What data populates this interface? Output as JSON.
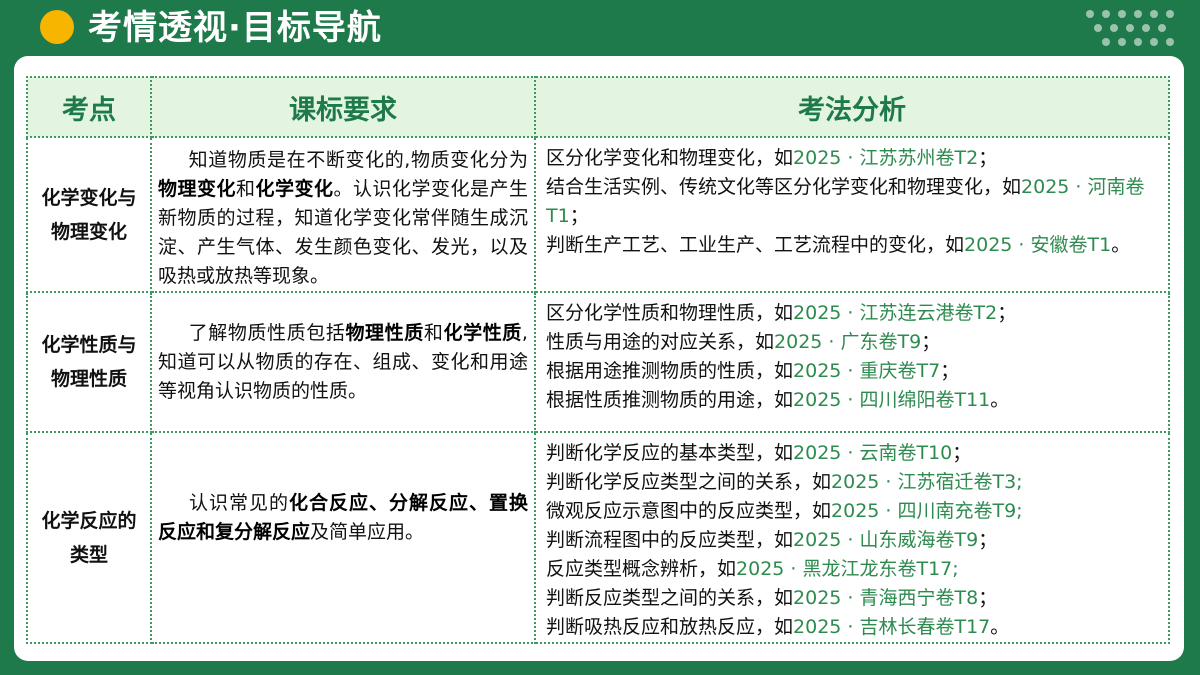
{
  "header": {
    "title": "考情透视·目标导航"
  },
  "colors": {
    "background": "#1f7a4b",
    "accent_dot": "#f7b500",
    "header_row": "#e3f4e1",
    "reference_text": "#2e8b4f"
  },
  "table": {
    "columns": [
      "考点",
      "课标要求",
      "考法分析"
    ],
    "rows": [
      {
        "topic": "化学变化与物理变化",
        "requirement": {
          "p1": "知道物质是在不断变化的,物质变化分为",
          "b1": "物理变化",
          "p2": "和",
          "b2": "化学变化",
          "p3": "。认识化学变化是产生新物质的过程，知道化学变化常伴随生成沉淀、产生气体、发生颜色变化、发光，以及吸热或放热等现象。"
        },
        "analysis": [
          {
            "text": "区分化学变化和物理变化，如",
            "ref": "2025 · 江苏苏州卷T2",
            "end": "；"
          },
          {
            "text": "结合生活实例、传统文化等区分化学变化和物理变化，如",
            "ref": "2025 · 河南卷T1",
            "end": "；"
          },
          {
            "text": "判断生产工艺、工业生产、工艺流程中的变化，如",
            "ref": "2025 · 安徽卷T1",
            "end": "。"
          }
        ]
      },
      {
        "topic": "化学性质与物理性质",
        "requirement": {
          "p1": "了解物质性质包括",
          "b1": "物理性质",
          "p2": "和",
          "b2": "化学性质",
          "p3": ",知道可以从物质的存在、组成、变化和用途等视角认识物质的性质。"
        },
        "analysis": [
          {
            "text": "区分化学性质和物理性质，如",
            "ref": "2025 · 江苏连云港卷T2",
            "end": "；"
          },
          {
            "text": "性质与用途的对应关系，如",
            "ref": "2025 · 广东卷T9",
            "end": "；"
          },
          {
            "text": "根据用途推测物质的性质，如",
            "ref": "2025 · 重庆卷T7",
            "end": "；"
          },
          {
            "text": "根据性质推测物质的用途，如",
            "ref": "2025 · 四川绵阳卷T11",
            "end": "。"
          }
        ]
      },
      {
        "topic": "化学反应的类型",
        "requirement": {
          "p1": "认识常见的",
          "b1": "化合反应、分解反应、置换反应和复分解反应",
          "p2": "",
          "b2": "",
          "p3": "及简单应用。"
        },
        "analysis": [
          {
            "text": "判断化学反应的基本类型，如",
            "ref": "2025 · 云南卷T10",
            "end": "；"
          },
          {
            "text": "判断化学反应类型之间的关系，如",
            "ref": "2025 · 江苏宿迁卷T3;",
            "end": ""
          },
          {
            "text": "微观反应示意图中的反应类型，如",
            "ref": "2025 · 四川南充卷T9;",
            "end": ""
          },
          {
            "text": "判断流程图中的反应类型，如",
            "ref": "2025 · 山东威海卷T9",
            "end": "；"
          },
          {
            "text": "反应类型概念辨析，如",
            "ref": "2025 · 黑龙江龙东卷T17;",
            "end": ""
          },
          {
            "text": "判断反应类型之间的关系，如",
            "ref": "2025 · 青海西宁卷T8",
            "end": "；"
          },
          {
            "text": "判断吸热反应和放热反应，如",
            "ref": "2025 · 吉林长春卷T17",
            "end": "。"
          }
        ]
      }
    ]
  }
}
